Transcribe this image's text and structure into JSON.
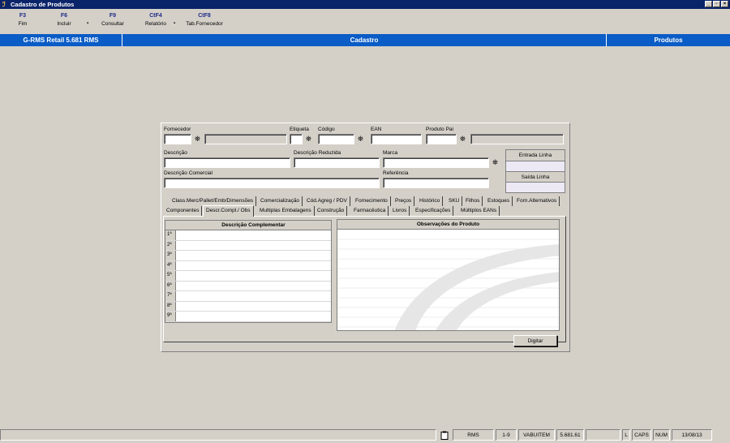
{
  "window": {
    "title": "Cadastro de Produtos",
    "buttons": [
      "_",
      "▫",
      "×"
    ]
  },
  "fkeys": [
    {
      "key": "F3",
      "label": "Fim"
    },
    {
      "key": "F6",
      "label": "Incluir"
    },
    {
      "key": "F9",
      "label": "Consultar"
    },
    {
      "key": "CtF4",
      "label": "Relatório"
    },
    {
      "key": "CtF8",
      "label": "Tab.Fornecedor"
    }
  ],
  "header": {
    "left": "G-RMS Retail 5.681 RMS",
    "center": "Cadastro",
    "right": "Produtos"
  },
  "form": {
    "fornecedor": "Fornecedor",
    "etiqueta": "Etiqueta",
    "codigo": "Código",
    "ean": "EAN",
    "produto_pai": "Produto Pai",
    "descricao": "Descrição",
    "descricao_reduzida": "Descrição Reduzida",
    "marca": "Marca",
    "descricao_comercial": "Descrição Comercial",
    "referencia": "Referência",
    "entrada_linha": "Entrada Linha",
    "saida_linha": "Saída Linha"
  },
  "tabs_row1": [
    "Class.Merc/Pallet/Emb/Dimensões",
    "Comercialização",
    "Cód.Agreg / PDV",
    "Fornecimento",
    "Preços",
    "Histórico",
    "SKU",
    "Filhos",
    "Estoques",
    "Forn.Alternativos"
  ],
  "tabs_row2": [
    "Componentes",
    "Descr.Compl./ Obs",
    "Multiplas Embalagens",
    "Construção",
    "Farmacêutica",
    "Livros",
    "Especificações",
    "Múltiplos EANs"
  ],
  "active_tab": "Descr.Compl./ Obs",
  "desc_compl": {
    "header": "Descrição Complementar",
    "rows": [
      "1ª",
      "2ª",
      "3ª",
      "4ª",
      "5ª",
      "6ª",
      "7ª",
      "8ª",
      "9ª"
    ]
  },
  "observacoes": {
    "header": "Observações do Produto"
  },
  "digitar_button": "Digitar",
  "status": {
    "s1": "RMS",
    "s2": "1-9",
    "s3": "VABUITEM",
    "s4": "5.681.61",
    "s5": "L",
    "s6": "CAPS",
    "s7": "NUM",
    "s8": "13/08/13"
  },
  "colors": {
    "title": "#0a246a",
    "header": "#0a5cc6",
    "face": "#d4d0c8"
  }
}
